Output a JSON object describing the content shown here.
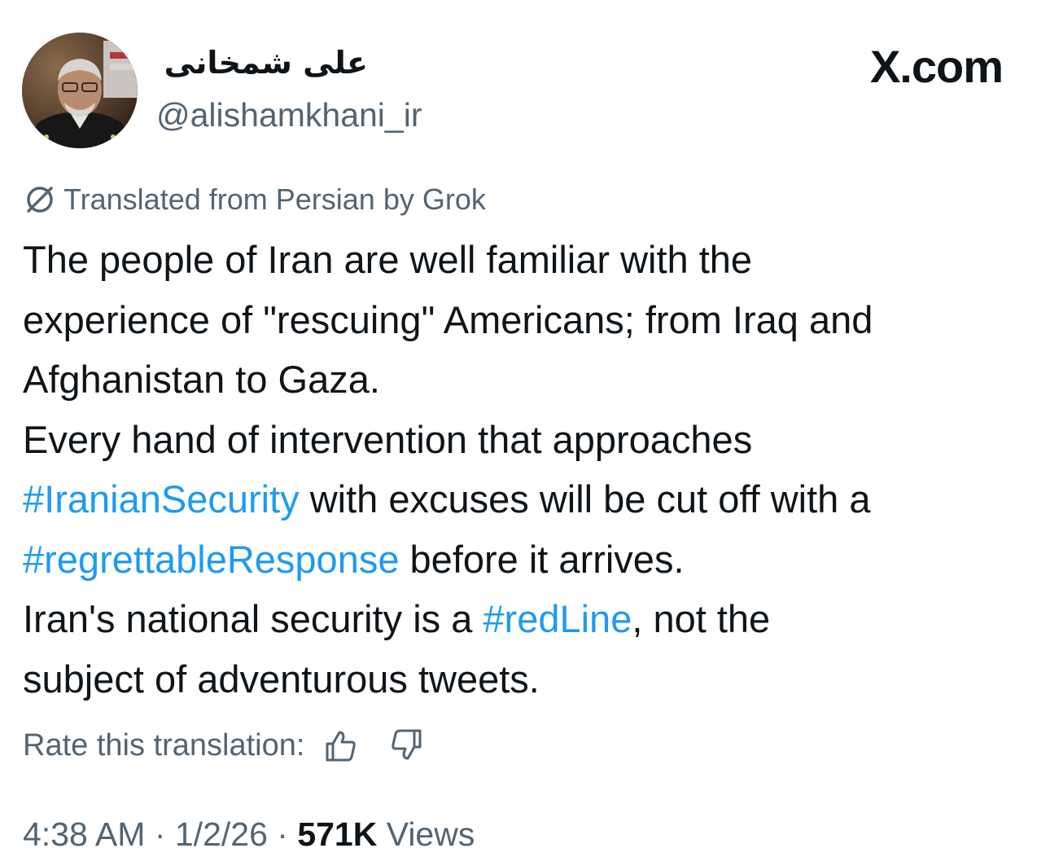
{
  "author": {
    "display_name": "علی شمخانی",
    "handle": "@alishamkhani_ir",
    "avatar_icon": "profile-photo"
  },
  "brand": {
    "label": "X.com"
  },
  "translation": {
    "notice": "Translated from Persian by Grok",
    "icon": "grok-icon",
    "rate_label": "Rate this translation:",
    "thumb_up_icon": "thumbs-up-icon",
    "thumb_down_icon": "thumbs-down-icon"
  },
  "tweet": {
    "lines": [
      "The people of Iran are well familiar with the",
      "experience of \"rescuing\" Americans; from Iraq and",
      "Afghanistan to Gaza.",
      "Every hand of intervention that approaches",
      "",
      "",
      "",
      ""
    ],
    "line5": {
      "hashtag": "#IranianSecurity",
      "rest": " with excuses will be cut off with a"
    },
    "line6": {
      "hashtag": "#regrettableResponse",
      "rest": " before it arrives."
    },
    "line7": {
      "before": "Iran's national security is a ",
      "hashtag": "#redLine",
      "after": ", not the"
    },
    "line8": "subject of adventurous tweets."
  },
  "meta": {
    "time": "4:38 AM",
    "date": "1/2/26",
    "separator": " · ",
    "views_count": "571K",
    "views_label": " Views"
  },
  "colors": {
    "text": "#0f1419",
    "secondary": "#536471",
    "hashtag": "#1d9bf0"
  }
}
